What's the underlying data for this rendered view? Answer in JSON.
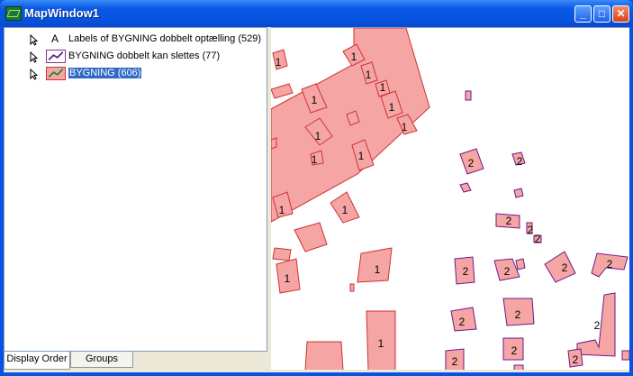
{
  "window": {
    "title": "MapWindow1"
  },
  "legend": {
    "layers": [
      {
        "label": "Labels of BYGNING dobbelt optælling (529)",
        "icon": "label-layer-icon",
        "selected": false
      },
      {
        "label": "BYGNING dobbelt kan slettes (77)",
        "icon": "line-layer-icon",
        "selected": false
      },
      {
        "label": "BYGNING (606)",
        "icon": "polygon-layer-icon",
        "selected": true
      }
    ],
    "tabs": [
      {
        "label": "Display Order"
      },
      {
        "label": "Groups"
      }
    ]
  },
  "map": {
    "building_labels": [
      "1",
      "1",
      "1",
      "1",
      "1",
      "1",
      "1",
      "1",
      "1",
      "1",
      "1",
      "1",
      "1",
      "1",
      "1",
      "2",
      "2",
      "2",
      "2",
      "2",
      "2",
      "2",
      "2",
      "2",
      "2",
      "2",
      "2",
      "2",
      "2",
      "2"
    ],
    "colors": {
      "fill": "#f6a5a5",
      "outline": "#cc3333",
      "outline_dup": "#6a1a8a"
    }
  }
}
